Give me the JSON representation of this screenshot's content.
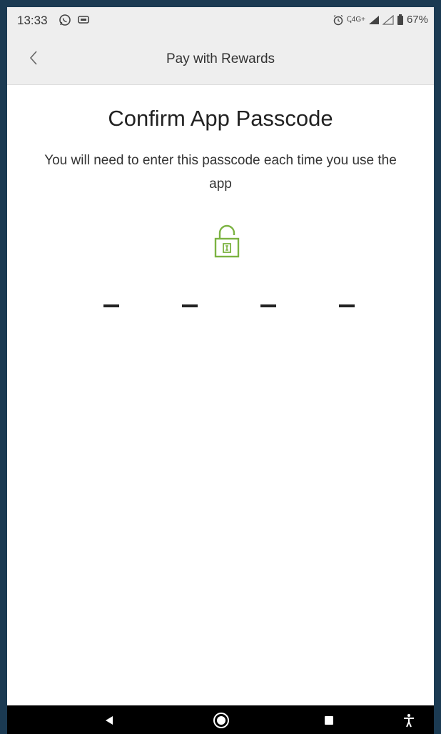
{
  "status_bar": {
    "time": "13:33",
    "network": "ↅ4G+",
    "battery": "67%",
    "icons_left": [
      "whatsapp-icon",
      "message-icon"
    ],
    "icons_right": [
      "alarm-icon",
      "signal-icon",
      "signal-empty-icon",
      "battery-icon"
    ]
  },
  "app_bar": {
    "title": "Pay with Rewards",
    "back_icon": "chevron-left-icon"
  },
  "content": {
    "title": "Confirm App Passcode",
    "subtitle": "You will need to enter this passcode each time you use the app",
    "lock_icon": "lock-icon",
    "lock_color": "#7cb342",
    "passcode_slots": 4,
    "entered_digits": 0
  },
  "nav_bar": {
    "buttons": [
      "back-icon",
      "home-icon",
      "recents-icon",
      "accessibility-icon"
    ]
  }
}
